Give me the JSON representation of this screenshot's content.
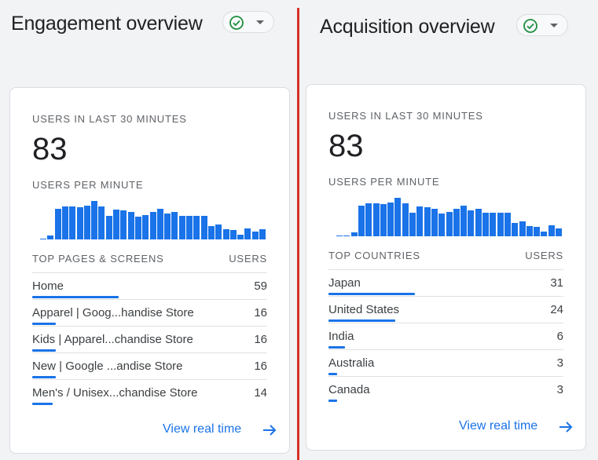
{
  "colors": {
    "accent": "#1a73e8",
    "divider": "#d93025",
    "ok": "#1e8e3e"
  },
  "icons": {
    "status": "check-circle-icon",
    "dropdown": "caret-down-icon",
    "link": "arrow-right-icon"
  },
  "engagement": {
    "title": "Engagement overview",
    "users_label": "USERS IN LAST 30 MINUTES",
    "users_count": "83",
    "per_minute_label": "USERS PER MINUTE",
    "per_minute": [
      1,
      4,
      33,
      35,
      35,
      34,
      36,
      41,
      35,
      25,
      32,
      31,
      29,
      24,
      26,
      29,
      33,
      28,
      29,
      25,
      25,
      25,
      25,
      14,
      16,
      11,
      10,
      5,
      12,
      8,
      11
    ],
    "table": {
      "col_name": "TOP PAGES & SCREENS",
      "col_value": "USERS",
      "rows": [
        {
          "name": "Home",
          "value": "59"
        },
        {
          "name": "Apparel | Goog...handise Store",
          "value": "16"
        },
        {
          "name": "Kids | Apparel...chandise Store",
          "value": "16"
        },
        {
          "name": "New | Google ...andise Store",
          "value": "16"
        },
        {
          "name": "Men's / Unisex...chandise Store",
          "value": "14"
        }
      ]
    },
    "link": "View real time"
  },
  "acquisition": {
    "title": "Acquisition overview",
    "users_label": "USERS IN LAST 30 MINUTES",
    "users_count": "83",
    "per_minute_label": "USERS PER MINUTE",
    "per_minute": [
      1,
      1,
      4,
      33,
      35,
      35,
      34,
      36,
      41,
      35,
      25,
      32,
      31,
      29,
      24,
      26,
      29,
      33,
      28,
      29,
      25,
      25,
      25,
      25,
      14,
      16,
      11,
      10,
      5,
      12,
      8
    ],
    "table": {
      "col_name": "TOP COUNTRIES",
      "col_value": "USERS",
      "rows": [
        {
          "name": "Japan",
          "value": "31"
        },
        {
          "name": "United States",
          "value": "24"
        },
        {
          "name": "India",
          "value": "6"
        },
        {
          "name": "Australia",
          "value": "3"
        },
        {
          "name": "Canada",
          "value": "3"
        }
      ]
    },
    "link": "View real time"
  }
}
